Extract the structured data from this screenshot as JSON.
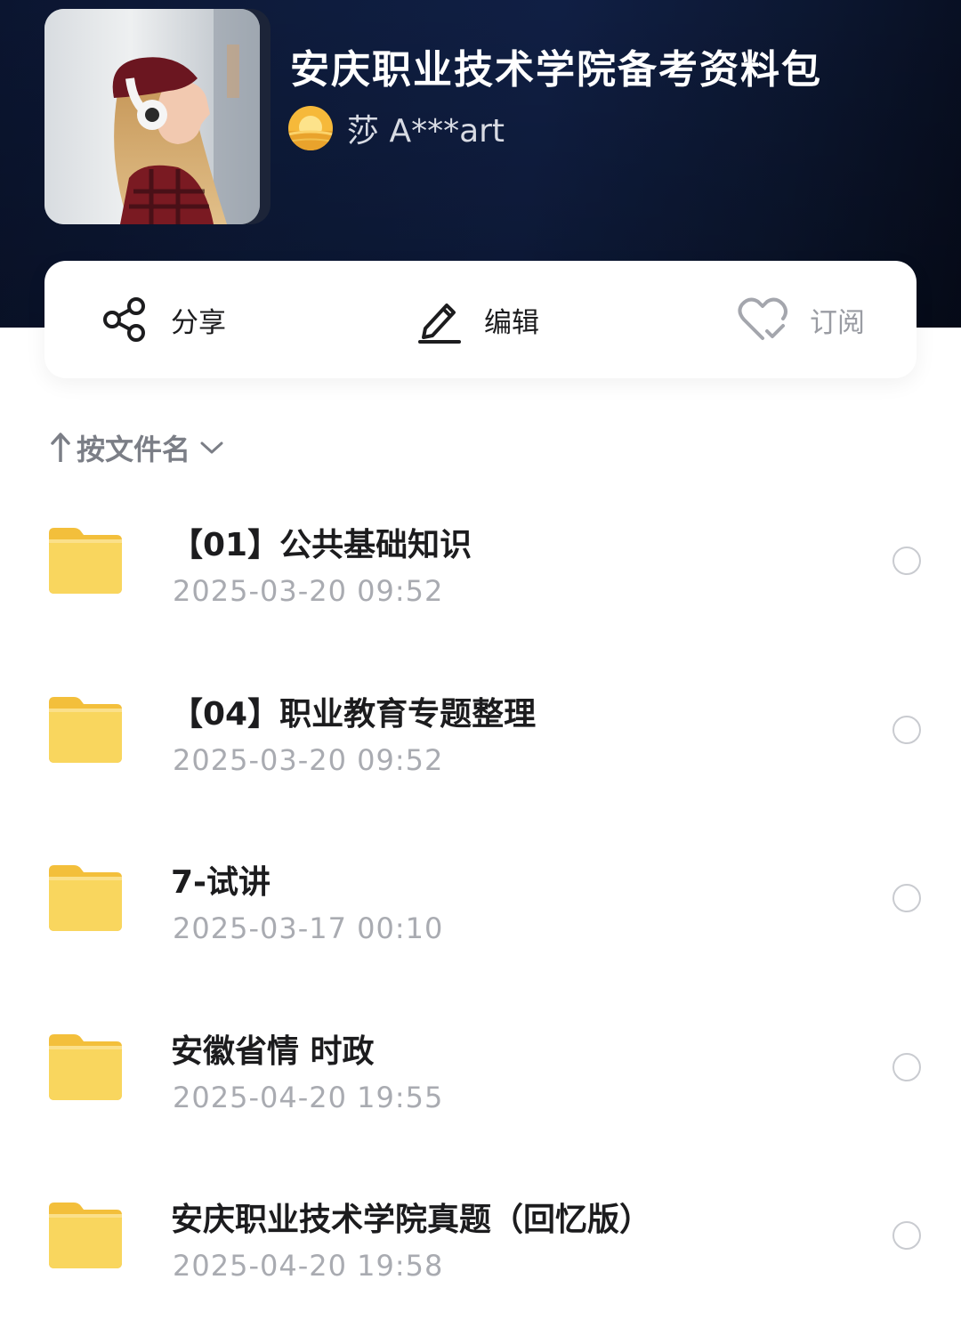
{
  "collection": {
    "title": "安庆职业技术学院备考资料包",
    "author_name": "莎 A***art",
    "cover_icon": "portrait-photo",
    "avatar_icon": "sunset-avatar"
  },
  "actions": {
    "share": {
      "label": "分享",
      "icon": "share-icon"
    },
    "edit": {
      "label": "编辑",
      "icon": "pencil-icon"
    },
    "subscribe": {
      "label": "订阅",
      "icon": "heart-check-icon"
    }
  },
  "sort": {
    "label": "按文件名",
    "direction_icon": "arrow-up-icon",
    "dropdown_icon": "chevron-down-icon"
  },
  "files": [
    {
      "name": "【01】公共基础知识",
      "date": "2025-03-20 09:52",
      "type": "folder"
    },
    {
      "name": "【04】职业教育专题整理",
      "date": "2025-03-20 09:52",
      "type": "folder"
    },
    {
      "name": "7-试讲",
      "date": "2025-03-17 00:10",
      "type": "folder"
    },
    {
      "name": "安徽省情 时政",
      "date": "2025-04-20 19:55",
      "type": "folder"
    },
    {
      "name": "安庆职业技术学院真题（回忆版）",
      "date": "2025-04-20 19:58",
      "type": "folder"
    }
  ],
  "colors": {
    "header_bg": "#0e1c3d",
    "folder_yellow": "#f8d25a",
    "text_primary": "#1c1c1e",
    "text_secondary": "#a9abb1"
  }
}
